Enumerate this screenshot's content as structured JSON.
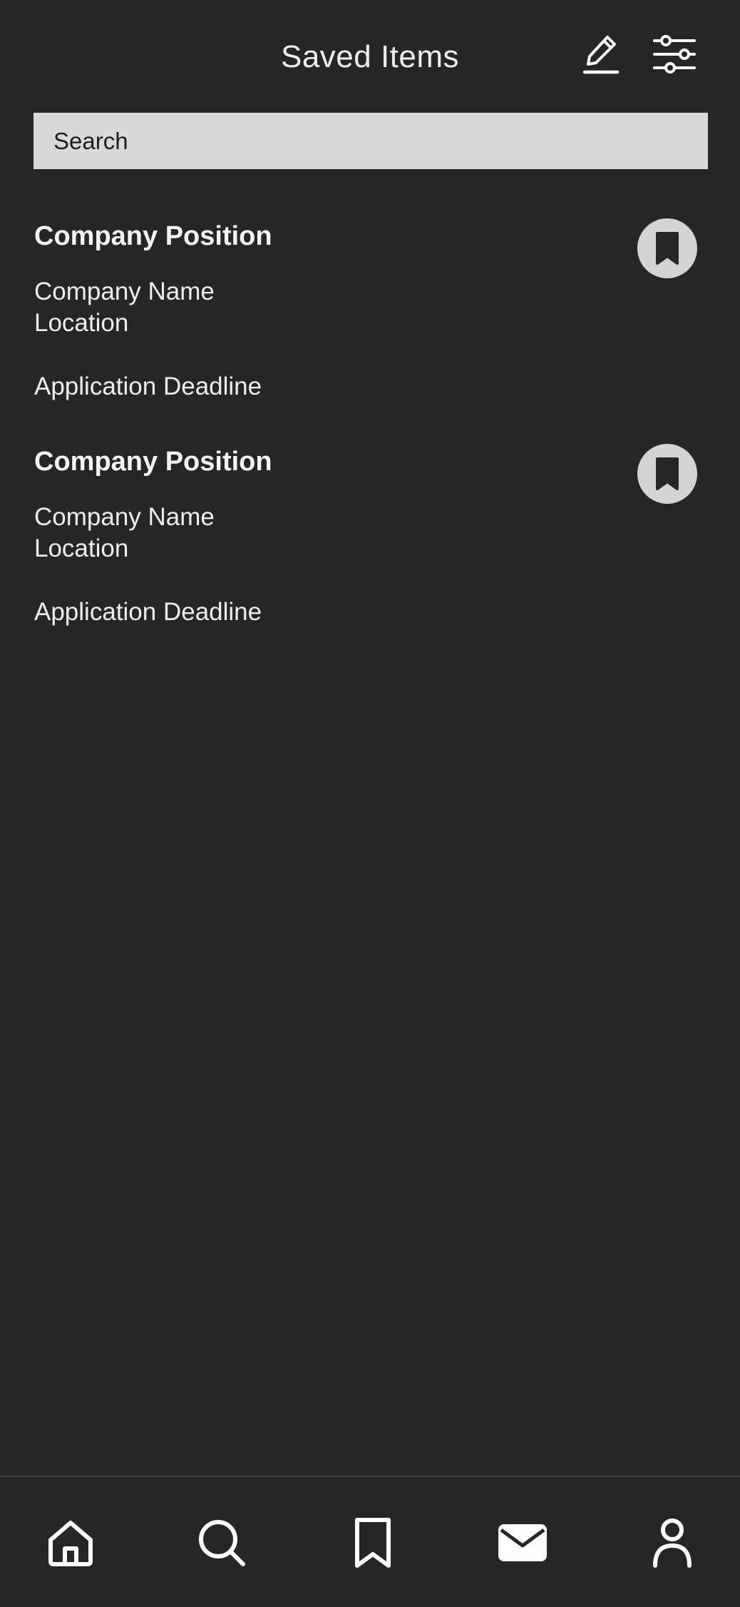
{
  "header": {
    "title": "Saved Items",
    "icons": {
      "edit": "edit-pencil-icon",
      "filter": "filter-sliders-icon"
    }
  },
  "search": {
    "placeholder": "Search"
  },
  "saved_jobs": [
    {
      "position": "Company Position",
      "company": "Company Name",
      "location": "Location",
      "deadline": "Application Deadline",
      "icon": "bookmark-icon"
    },
    {
      "position": "Company Position",
      "company": "Company Name",
      "location": "Location",
      "deadline": "Application Deadline",
      "icon": "bookmark-icon"
    }
  ],
  "bottom_nav": {
    "items": [
      {
        "icon": "home-icon"
      },
      {
        "icon": "search-icon"
      },
      {
        "icon": "bookmark-icon"
      },
      {
        "icon": "mail-icon"
      },
      {
        "icon": "profile-icon"
      }
    ]
  },
  "colors": {
    "background": "#262626",
    "search_bg": "#d9d9d9",
    "bookmark_circle": "#d4d4d4",
    "text": "#f2f2f2"
  }
}
